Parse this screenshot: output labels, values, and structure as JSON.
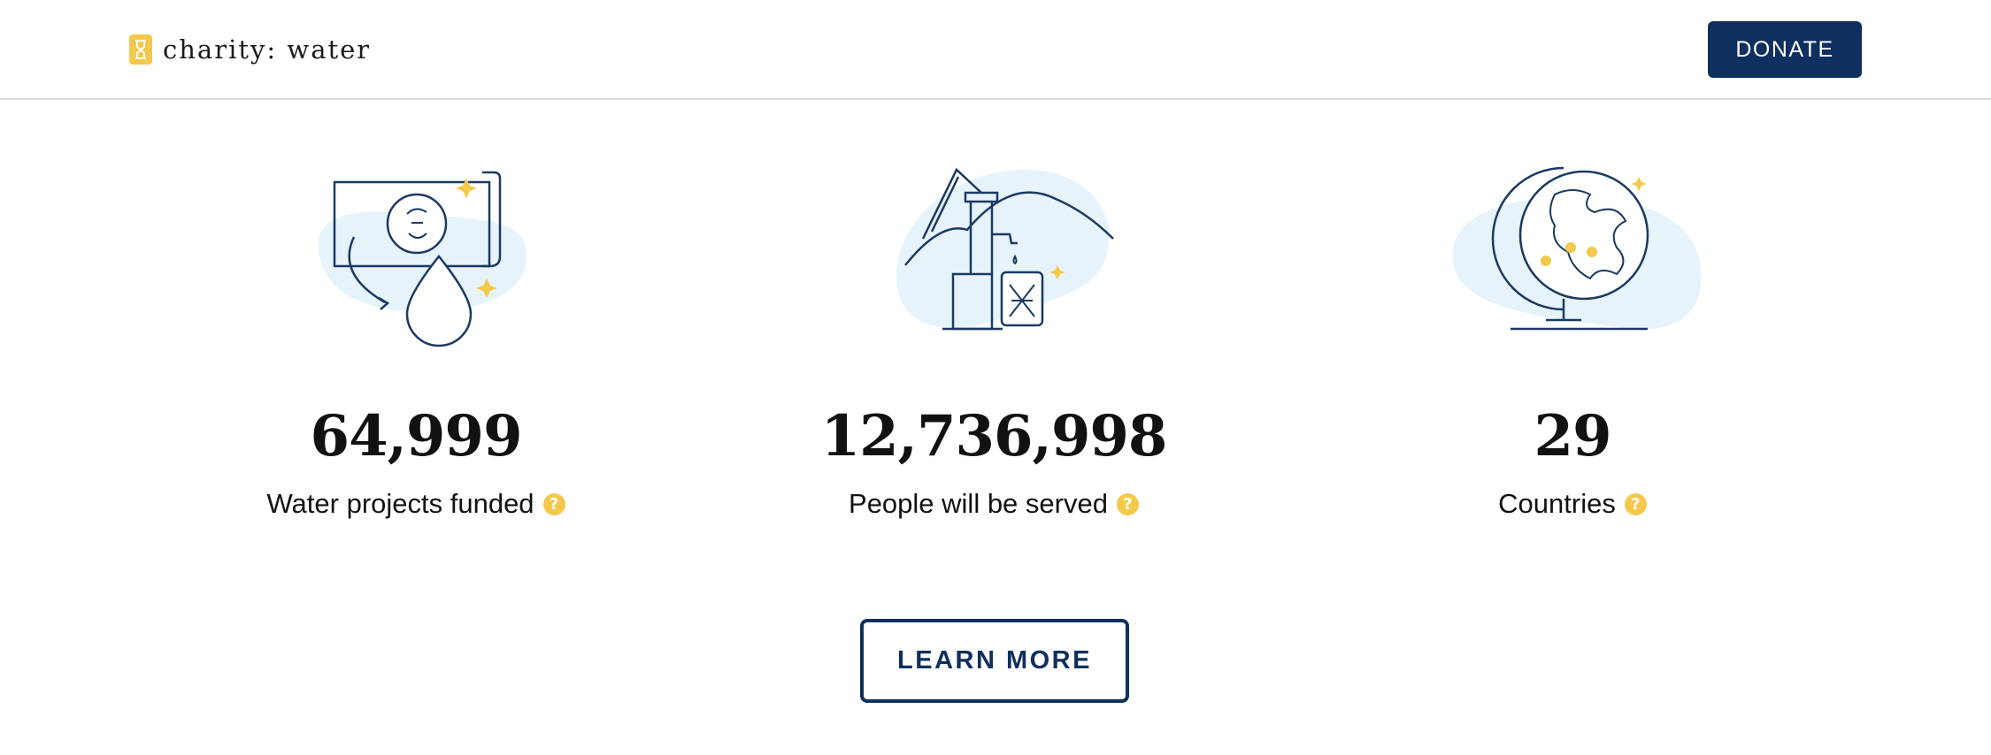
{
  "header": {
    "logo_text": "charity: water",
    "donate_label": "DONATE"
  },
  "stats": [
    {
      "icon": "map-water-drop-icon",
      "value": "64,999",
      "label": "Water projects funded"
    },
    {
      "icon": "water-pump-icon",
      "value": "12,736,998",
      "label": "People will be served"
    },
    {
      "icon": "globe-icon",
      "value": "29",
      "label": "Countries"
    }
  ],
  "help_glyph": "?",
  "learn_more_label": "LEARN MORE",
  "colors": {
    "navy": "#0f2f5e",
    "yellow": "#f4c84a",
    "light_blue": "#e6f3fa",
    "divider": "#dcdcdc"
  }
}
